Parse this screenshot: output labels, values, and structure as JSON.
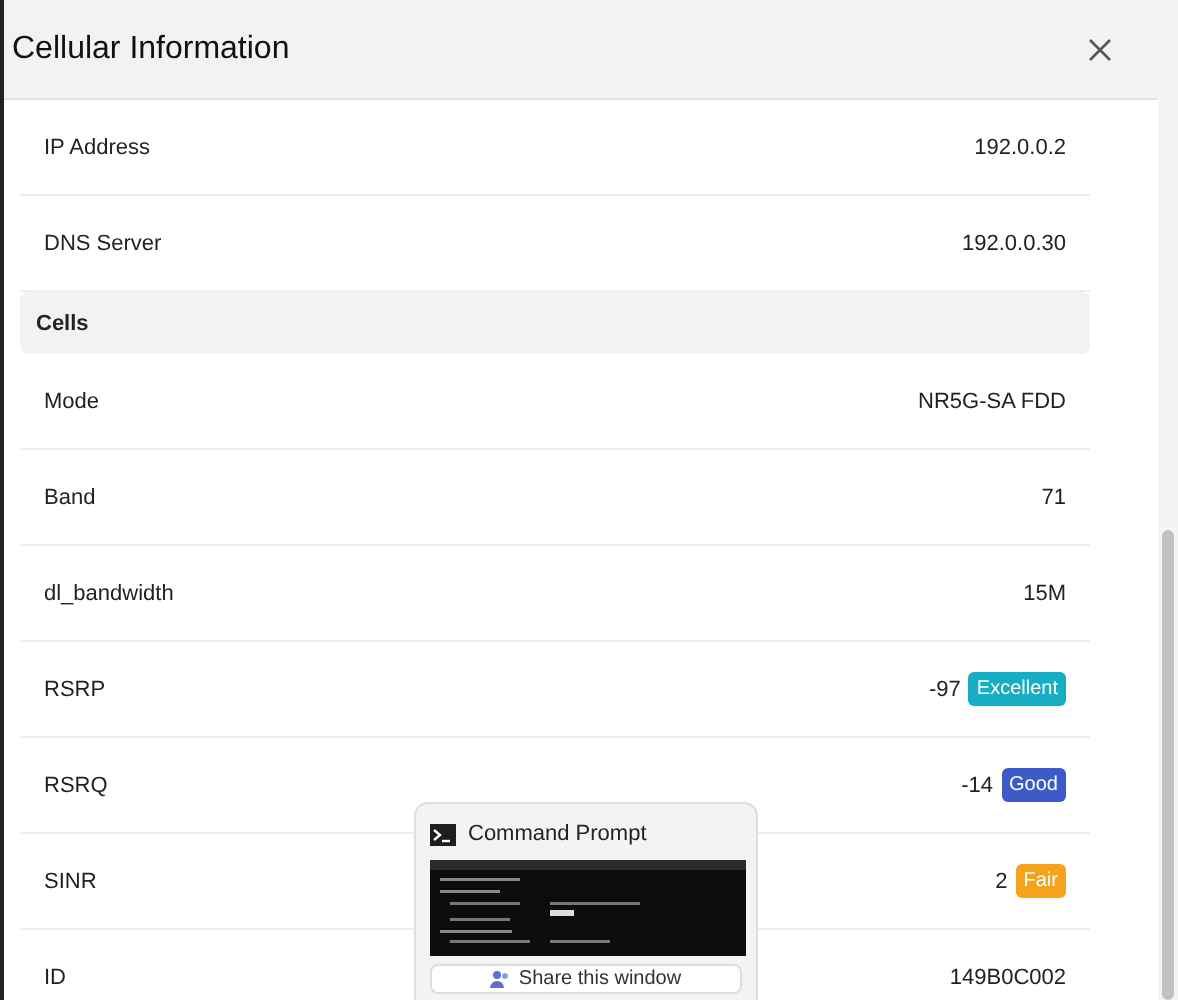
{
  "dialog": {
    "title": "Cellular Information"
  },
  "rows": [
    {
      "label": "IP Address",
      "value": "192.0.0.2"
    },
    {
      "label": "DNS Server",
      "value": "192.0.0.30"
    }
  ],
  "section": {
    "title": "Cells"
  },
  "cell_rows": [
    {
      "label": "Mode",
      "value": "NR5G-SA FDD"
    },
    {
      "label": "Band",
      "value": "71"
    },
    {
      "label": "dl_bandwidth",
      "value": "15M"
    },
    {
      "label": "RSRP",
      "value": "-97",
      "badge": {
        "label": "Excellent",
        "color": "#17adc2"
      }
    },
    {
      "label": "RSRQ",
      "value": "-14",
      "badge": {
        "label": "Good",
        "color": "#3d5bc8"
      }
    },
    {
      "label": "SINR",
      "value": "2",
      "badge": {
        "label": "Fair",
        "color": "#f5a31e"
      }
    },
    {
      "label": "ID",
      "value": "149B0C002"
    }
  ],
  "taskbar_preview": {
    "title": "Command Prompt",
    "action": "Share this window"
  }
}
